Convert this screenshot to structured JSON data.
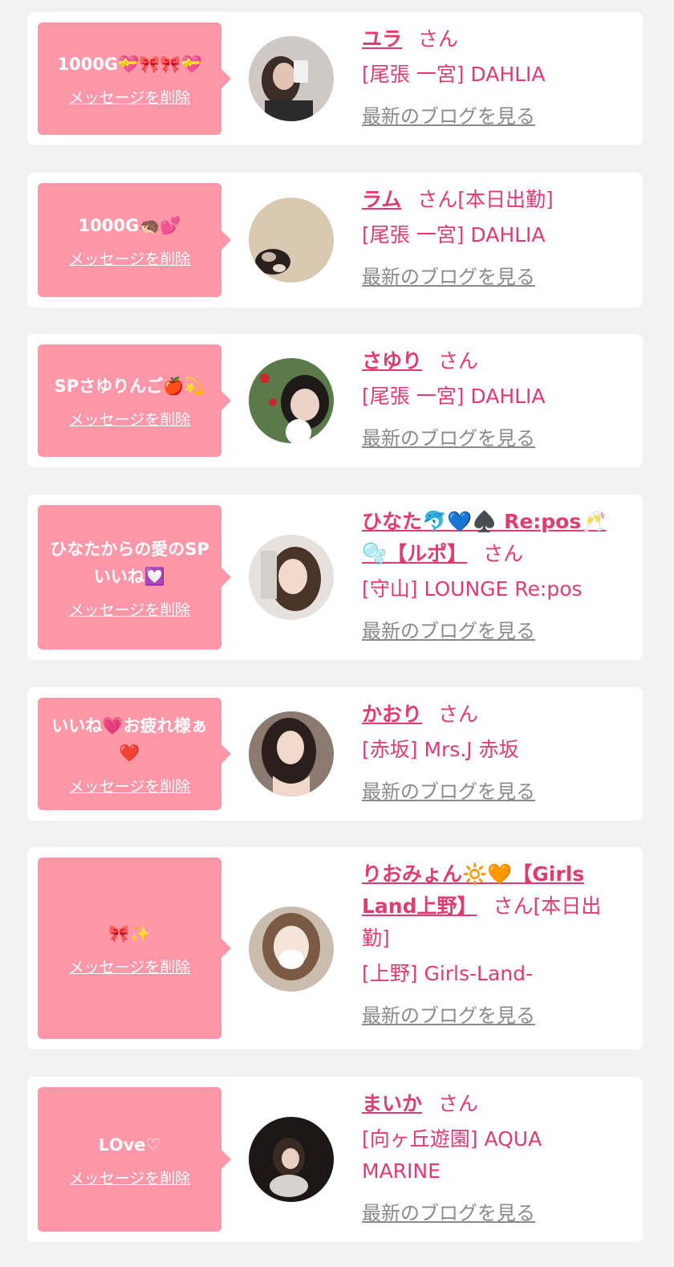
{
  "common": {
    "delete_label": "メッセージを削除",
    "blog_label": "最新のブログを見る",
    "honorific": "さん"
  },
  "items": [
    {
      "message": "1000G💝🎀🎀💝",
      "name": "ユラ",
      "status": "",
      "shop": "[尾張 一宮] DAHLIA",
      "avatar": "avatar-photo"
    },
    {
      "message": "1000G🦔💕",
      "name": "ラム",
      "status": "[本日出勤]",
      "shop": "[尾張 一宮] DAHLIA",
      "avatar": "avatar-photo"
    },
    {
      "message": "SPさゆりんご🍎💫",
      "name": "さゆり",
      "status": "",
      "shop": "[尾張 一宮] DAHLIA",
      "avatar": "avatar-photo"
    },
    {
      "message": "ひなたからの愛のSPいいね💟",
      "name": "ひなた🐬💙♠️ Re:pos🥂🫧【ルポ】",
      "status": "",
      "shop": "[守山] LOUNGE Re:pos",
      "avatar": "avatar-photo"
    },
    {
      "message": "いいね💗お疲れ様ぁ❤️",
      "name": "かおり",
      "status": "",
      "shop": "[赤坂] Mrs.J 赤坂",
      "avatar": "avatar-photo"
    },
    {
      "message": "🎀✨",
      "name": "りおみょん🔆🧡【Girls Land上野】",
      "status": "[本日出勤]",
      "shop": "[上野] Girls-Land-",
      "avatar": "avatar-photo"
    },
    {
      "message": "ᒪOve♡",
      "name": "まいか",
      "status": "",
      "shop": "[向ヶ丘遊園] AQUA MARINE",
      "avatar": "avatar-photo"
    }
  ],
  "colors": {
    "page_bg": "#f2f2f2",
    "card_bg": "#ffffff",
    "bubble_bg": "#ff97a8",
    "accent": "#e23b70",
    "link_gray": "#8a8a8a"
  }
}
